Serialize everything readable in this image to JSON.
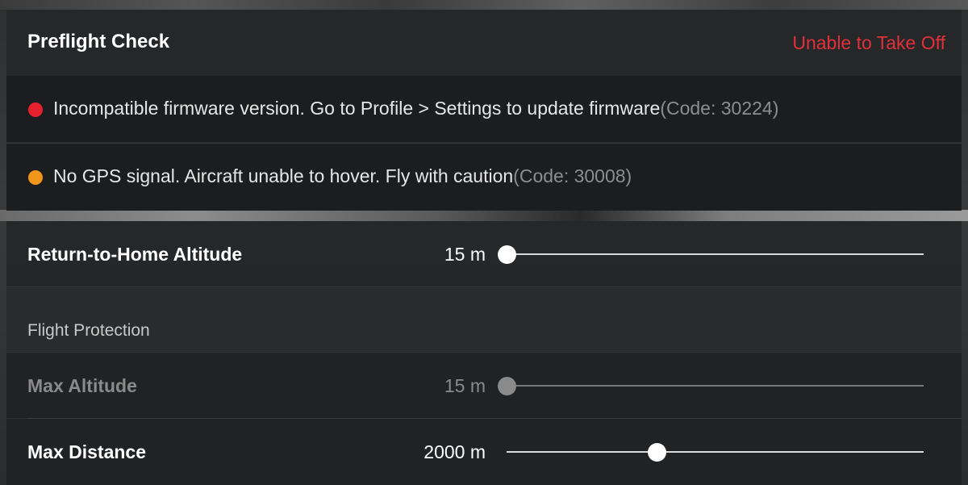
{
  "header": {
    "title": "Preflight Check",
    "status": "Unable to Take Off",
    "status_color": "#e2303b"
  },
  "warnings": [
    {
      "message": "Incompatible firmware version. Go to Profile > Settings to update firmware",
      "code": "(Code: 30224)",
      "severity_color": "#e8212f"
    },
    {
      "message": "No GPS signal. Aircraft unable to hover. Fly with caution",
      "code": "(Code: 30008)",
      "severity_color": "#f0961c"
    }
  ],
  "return_to_home": {
    "label": "Return-to-Home Altitude",
    "value": "15 m",
    "slider_fraction": 0.0
  },
  "flight_protection": {
    "section_label": "Flight Protection",
    "max_altitude": {
      "label": "Max Altitude",
      "value": "15 m",
      "slider_fraction": 0.0,
      "enabled": false
    },
    "max_distance": {
      "label": "Max Distance",
      "value": "2000 m",
      "slider_fraction": 0.36,
      "enabled": true
    }
  }
}
